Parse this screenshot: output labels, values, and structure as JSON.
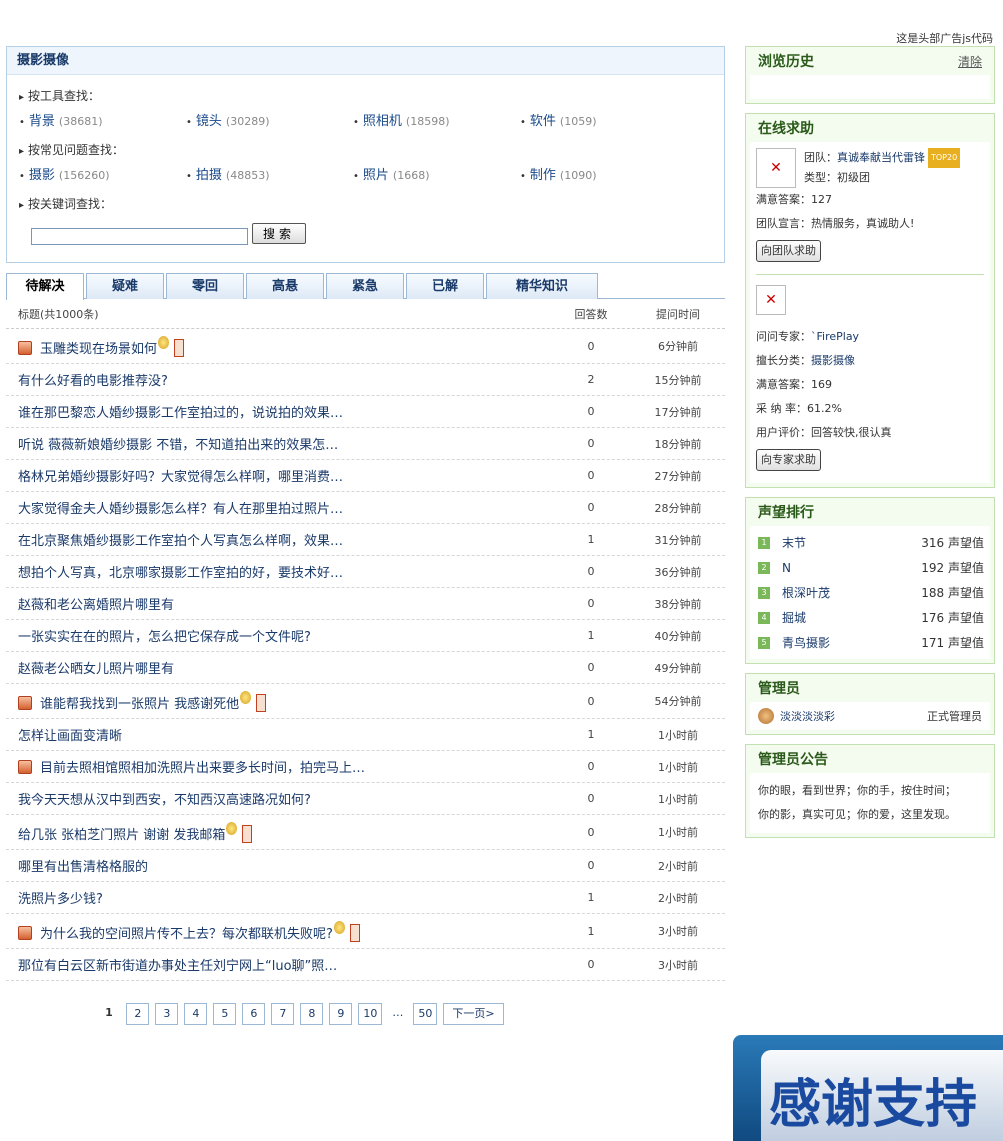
{
  "top_ad": "这是头部广告js代码",
  "category": {
    "title": "摄影摄像",
    "tool_label": "按工具查找：",
    "tools": [
      {
        "name": "背景",
        "count": "(38681)"
      },
      {
        "name": "镜头",
        "count": "(30289)"
      },
      {
        "name": "照相机",
        "count": "(18598)"
      },
      {
        "name": "软件",
        "count": "(1059)"
      }
    ],
    "faq_label": "按常见问题查找：",
    "faqs": [
      {
        "name": "摄影",
        "count": "(156260)"
      },
      {
        "name": "拍摄",
        "count": "(48853)"
      },
      {
        "name": "照片",
        "count": "(1668)"
      },
      {
        "name": "制作",
        "count": "(1090)"
      }
    ],
    "keyword_label": "按关键词查找：",
    "search_value": "",
    "search_button": "搜索"
  },
  "tabs": [
    "待解决",
    "疑难",
    "零回",
    "高悬",
    "紧急",
    "已解",
    "精华知识"
  ],
  "table": {
    "col_title": "标题(共1000条)",
    "col_answers": "回答数",
    "col_time": "提问时间",
    "rows": [
      {
        "title": "玉雕类现在场景如何",
        "answers": "0",
        "time": "6分钟前"
      },
      {
        "title": "有什么好看的电影推荐没?",
        "answers": "2",
        "time": "15分钟前"
      },
      {
        "title": "谁在那巴黎恋人婚纱摄影工作室拍过的，说说拍的效果…",
        "answers": "0",
        "time": "17分钟前"
      },
      {
        "title": "听说 薇薇新娘婚纱摄影 不错，不知道拍出来的效果怎…",
        "answers": "0",
        "time": "18分钟前"
      },
      {
        "title": "格林兄弟婚纱摄影好吗？大家觉得怎么样啊，哪里消费…",
        "answers": "0",
        "time": "27分钟前"
      },
      {
        "title": "大家觉得金夫人婚纱摄影怎么样？有人在那里拍过照片…",
        "answers": "0",
        "time": "28分钟前"
      },
      {
        "title": "在北京聚焦婚纱摄影工作室拍个人写真怎么样啊，效果…",
        "answers": "1",
        "time": "31分钟前"
      },
      {
        "title": "想拍个人写真，北京哪家摄影工作室拍的好，要技术好…",
        "answers": "0",
        "time": "36分钟前"
      },
      {
        "title": "赵薇和老公离婚照片哪里有",
        "answers": "0",
        "time": "38分钟前"
      },
      {
        "title": "一张实实在在的照片，怎么把它保存成一个文件呢?",
        "answers": "1",
        "time": "40分钟前"
      },
      {
        "title": "赵薇老公晒女儿照片哪里有",
        "answers": "0",
        "time": "49分钟前"
      },
      {
        "title": "谁能帮我找到一张照片 我感谢死他",
        "answers": "0",
        "time": "54分钟前"
      },
      {
        "title": "怎样让画面变清晰",
        "answers": "1",
        "time": "1小时前"
      },
      {
        "title": "目前去照相馆照相加洗照片出来要多长时间，拍完马上…",
        "answers": "0",
        "time": "1小时前"
      },
      {
        "title": "我今天天想从汉中到西安，不知西汉高速路况如何?",
        "answers": "0",
        "time": "1小时前"
      },
      {
        "title": "给几张 张柏芝门照片 谢谢 发我邮箱",
        "answers": "0",
        "time": "1小时前"
      },
      {
        "title": "哪里有出售清格格服的",
        "answers": "0",
        "time": "2小时前"
      },
      {
        "title": "洗照片多少钱?",
        "answers": "1",
        "time": "2小时前"
      },
      {
        "title": "为什么我的空间照片传不上去？每次都联机失败呢?",
        "answers": "1",
        "time": "3小时前"
      },
      {
        "title": "那位有白云区新市街道办事处主任刘宁网上“luo聊”照…",
        "answers": "0",
        "time": "3小时前"
      }
    ]
  },
  "pager": {
    "current": "1",
    "pages": [
      "2",
      "3",
      "4",
      "5",
      "6",
      "7",
      "8",
      "9",
      "10"
    ],
    "dots": "…",
    "last": "50",
    "next": "下一页>"
  },
  "history": {
    "title": "浏览历史",
    "clear": "清除"
  },
  "help": {
    "title": "在线求助",
    "team_label": "团队：",
    "team_name": "真诚奉献当代雷锋",
    "team_badge": "TOP20",
    "team_type": "类型：初级团",
    "team_satisfied": "满意答案：127",
    "team_motto": "团队宣言：热情服务，真诚助人!",
    "team_button": "向团队求助",
    "expert_label": "问问专家：",
    "expert_name": "`FirePlay",
    "expert_field_label": "擅长分类：",
    "expert_field": "摄影摄像",
    "expert_satisfied": "满意答案：169",
    "expert_rate": "采 纳 率：61.2%",
    "expert_review": "用户评价：回答较快,很认真",
    "expert_button": "向专家求助"
  },
  "ranking": {
    "title": "声望排行",
    "items": [
      {
        "num": "1",
        "name": "末节",
        "score": "316 声望值"
      },
      {
        "num": "2",
        "name": "N",
        "score": "192 声望值"
      },
      {
        "num": "3",
        "name": "根深叶茂",
        "score": "188 声望值"
      },
      {
        "num": "4",
        "name": "掘城",
        "score": "176 声望值"
      },
      {
        "num": "5",
        "name": "青鸟摄影",
        "score": "171 声望值"
      }
    ]
  },
  "admin": {
    "title": "管理员",
    "name": "淡淡淡淡彩",
    "role": "正式管理员"
  },
  "notice": {
    "title": "管理员公告",
    "line1": "你的眼，看到世界；你的手，按住时间；",
    "line2": "你的影，真实可见；你的爱，这里发现。"
  },
  "banner": {
    "text": "感谢支持"
  }
}
